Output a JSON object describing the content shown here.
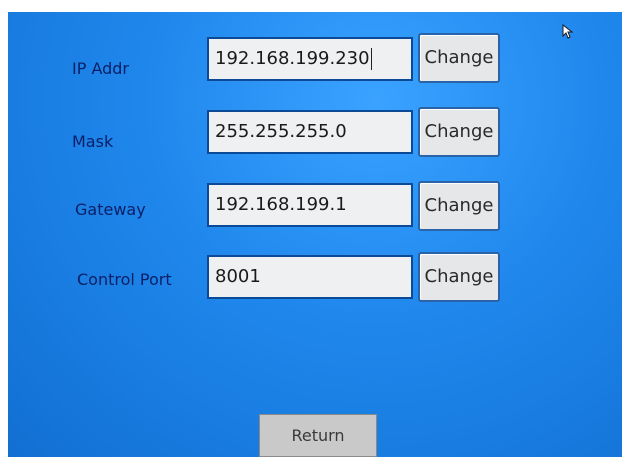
{
  "network_settings": {
    "rows": [
      {
        "label": "IP Addr",
        "value": "192.168.199.230",
        "button": "Change"
      },
      {
        "label": "Mask",
        "value": "255.255.255.0",
        "button": "Change"
      },
      {
        "label": "Gateway",
        "value": "192.168.199.1",
        "button": "Change"
      },
      {
        "label": "Control Port",
        "value": "8001",
        "button": "Change"
      }
    ],
    "return_label": "Return"
  },
  "colors": {
    "background": "#1f87ec",
    "label_text": "#0b1f66",
    "field_bg": "#eef0f1",
    "button_bg": "#e6e7e8"
  },
  "icons": {
    "pointer": "mouse-pointer-icon"
  }
}
